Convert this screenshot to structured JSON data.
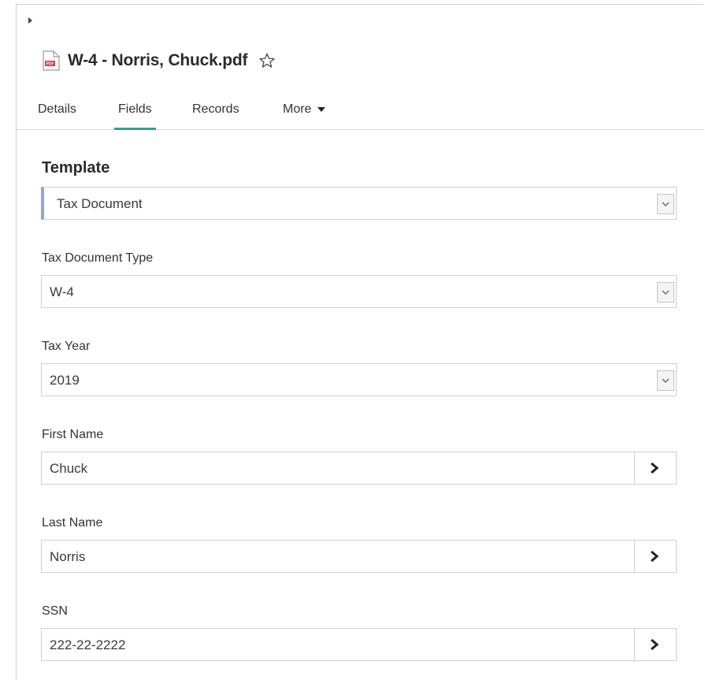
{
  "document": {
    "title": "W-4 - Norris, Chuck.pdf",
    "file_icon": "pdf-file-icon",
    "favorite_icon": "star-outline-icon"
  },
  "tabs": [
    {
      "label": "Details",
      "active": false
    },
    {
      "label": "Fields",
      "active": true
    },
    {
      "label": "Records",
      "active": false
    },
    {
      "label": "More",
      "active": false,
      "icon": "caret-down-icon"
    }
  ],
  "accent_color": "#2ba48a",
  "template": {
    "label": "Template",
    "value": "Tax Document"
  },
  "fields": [
    {
      "label": "Tax Document Type",
      "value": "W-4",
      "kind": "select"
    },
    {
      "label": "Tax Year",
      "value": "2019",
      "kind": "select"
    },
    {
      "label": "First Name",
      "value": "Chuck",
      "kind": "lookup"
    },
    {
      "label": "Last Name",
      "value": "Norris",
      "kind": "lookup"
    },
    {
      "label": "SSN",
      "value": "222-22-2222",
      "kind": "lookup"
    }
  ]
}
